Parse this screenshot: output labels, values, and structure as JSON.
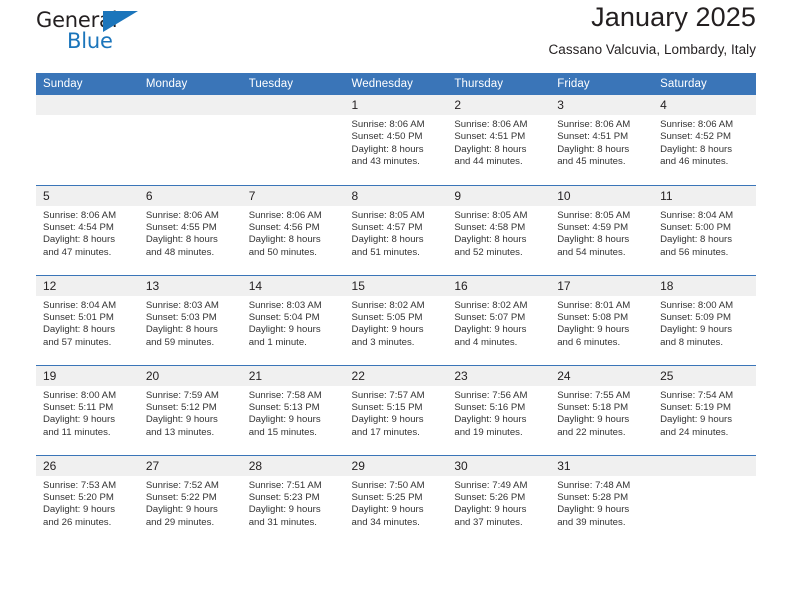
{
  "logo": {
    "word_top": "General",
    "word_bottom": "Blue",
    "triangle_color": "#1b75bb"
  },
  "header": {
    "month_title": "January 2025",
    "location": "Cassano Valcuvia, Lombardy, Italy"
  },
  "theme": {
    "header_blue": "#3a75b8",
    "daynum_band": "#f0f0f0",
    "text": "#231f20"
  },
  "weekdays": [
    "Sunday",
    "Monday",
    "Tuesday",
    "Wednesday",
    "Thursday",
    "Friday",
    "Saturday"
  ],
  "weeks": [
    [
      {
        "day": "",
        "empty": true
      },
      {
        "day": "",
        "empty": true
      },
      {
        "day": "",
        "empty": true
      },
      {
        "day": "1",
        "sunrise": "Sunrise: 8:06 AM",
        "sunset": "Sunset: 4:50 PM",
        "daylight1": "Daylight: 8 hours",
        "daylight2": "and 43 minutes."
      },
      {
        "day": "2",
        "sunrise": "Sunrise: 8:06 AM",
        "sunset": "Sunset: 4:51 PM",
        "daylight1": "Daylight: 8 hours",
        "daylight2": "and 44 minutes."
      },
      {
        "day": "3",
        "sunrise": "Sunrise: 8:06 AM",
        "sunset": "Sunset: 4:51 PM",
        "daylight1": "Daylight: 8 hours",
        "daylight2": "and 45 minutes."
      },
      {
        "day": "4",
        "sunrise": "Sunrise: 8:06 AM",
        "sunset": "Sunset: 4:52 PM",
        "daylight1": "Daylight: 8 hours",
        "daylight2": "and 46 minutes."
      }
    ],
    [
      {
        "day": "5",
        "sunrise": "Sunrise: 8:06 AM",
        "sunset": "Sunset: 4:54 PM",
        "daylight1": "Daylight: 8 hours",
        "daylight2": "and 47 minutes."
      },
      {
        "day": "6",
        "sunrise": "Sunrise: 8:06 AM",
        "sunset": "Sunset: 4:55 PM",
        "daylight1": "Daylight: 8 hours",
        "daylight2": "and 48 minutes."
      },
      {
        "day": "7",
        "sunrise": "Sunrise: 8:06 AM",
        "sunset": "Sunset: 4:56 PM",
        "daylight1": "Daylight: 8 hours",
        "daylight2": "and 50 minutes."
      },
      {
        "day": "8",
        "sunrise": "Sunrise: 8:05 AM",
        "sunset": "Sunset: 4:57 PM",
        "daylight1": "Daylight: 8 hours",
        "daylight2": "and 51 minutes."
      },
      {
        "day": "9",
        "sunrise": "Sunrise: 8:05 AM",
        "sunset": "Sunset: 4:58 PM",
        "daylight1": "Daylight: 8 hours",
        "daylight2": "and 52 minutes."
      },
      {
        "day": "10",
        "sunrise": "Sunrise: 8:05 AM",
        "sunset": "Sunset: 4:59 PM",
        "daylight1": "Daylight: 8 hours",
        "daylight2": "and 54 minutes."
      },
      {
        "day": "11",
        "sunrise": "Sunrise: 8:04 AM",
        "sunset": "Sunset: 5:00 PM",
        "daylight1": "Daylight: 8 hours",
        "daylight2": "and 56 minutes."
      }
    ],
    [
      {
        "day": "12",
        "sunrise": "Sunrise: 8:04 AM",
        "sunset": "Sunset: 5:01 PM",
        "daylight1": "Daylight: 8 hours",
        "daylight2": "and 57 minutes."
      },
      {
        "day": "13",
        "sunrise": "Sunrise: 8:03 AM",
        "sunset": "Sunset: 5:03 PM",
        "daylight1": "Daylight: 8 hours",
        "daylight2": "and 59 minutes."
      },
      {
        "day": "14",
        "sunrise": "Sunrise: 8:03 AM",
        "sunset": "Sunset: 5:04 PM",
        "daylight1": "Daylight: 9 hours",
        "daylight2": "and 1 minute."
      },
      {
        "day": "15",
        "sunrise": "Sunrise: 8:02 AM",
        "sunset": "Sunset: 5:05 PM",
        "daylight1": "Daylight: 9 hours",
        "daylight2": "and 3 minutes."
      },
      {
        "day": "16",
        "sunrise": "Sunrise: 8:02 AM",
        "sunset": "Sunset: 5:07 PM",
        "daylight1": "Daylight: 9 hours",
        "daylight2": "and 4 minutes."
      },
      {
        "day": "17",
        "sunrise": "Sunrise: 8:01 AM",
        "sunset": "Sunset: 5:08 PM",
        "daylight1": "Daylight: 9 hours",
        "daylight2": "and 6 minutes."
      },
      {
        "day": "18",
        "sunrise": "Sunrise: 8:00 AM",
        "sunset": "Sunset: 5:09 PM",
        "daylight1": "Daylight: 9 hours",
        "daylight2": "and 8 minutes."
      }
    ],
    [
      {
        "day": "19",
        "sunrise": "Sunrise: 8:00 AM",
        "sunset": "Sunset: 5:11 PM",
        "daylight1": "Daylight: 9 hours",
        "daylight2": "and 11 minutes."
      },
      {
        "day": "20",
        "sunrise": "Sunrise: 7:59 AM",
        "sunset": "Sunset: 5:12 PM",
        "daylight1": "Daylight: 9 hours",
        "daylight2": "and 13 minutes."
      },
      {
        "day": "21",
        "sunrise": "Sunrise: 7:58 AM",
        "sunset": "Sunset: 5:13 PM",
        "daylight1": "Daylight: 9 hours",
        "daylight2": "and 15 minutes."
      },
      {
        "day": "22",
        "sunrise": "Sunrise: 7:57 AM",
        "sunset": "Sunset: 5:15 PM",
        "daylight1": "Daylight: 9 hours",
        "daylight2": "and 17 minutes."
      },
      {
        "day": "23",
        "sunrise": "Sunrise: 7:56 AM",
        "sunset": "Sunset: 5:16 PM",
        "daylight1": "Daylight: 9 hours",
        "daylight2": "and 19 minutes."
      },
      {
        "day": "24",
        "sunrise": "Sunrise: 7:55 AM",
        "sunset": "Sunset: 5:18 PM",
        "daylight1": "Daylight: 9 hours",
        "daylight2": "and 22 minutes."
      },
      {
        "day": "25",
        "sunrise": "Sunrise: 7:54 AM",
        "sunset": "Sunset: 5:19 PM",
        "daylight1": "Daylight: 9 hours",
        "daylight2": "and 24 minutes."
      }
    ],
    [
      {
        "day": "26",
        "sunrise": "Sunrise: 7:53 AM",
        "sunset": "Sunset: 5:20 PM",
        "daylight1": "Daylight: 9 hours",
        "daylight2": "and 26 minutes."
      },
      {
        "day": "27",
        "sunrise": "Sunrise: 7:52 AM",
        "sunset": "Sunset: 5:22 PM",
        "daylight1": "Daylight: 9 hours",
        "daylight2": "and 29 minutes."
      },
      {
        "day": "28",
        "sunrise": "Sunrise: 7:51 AM",
        "sunset": "Sunset: 5:23 PM",
        "daylight1": "Daylight: 9 hours",
        "daylight2": "and 31 minutes."
      },
      {
        "day": "29",
        "sunrise": "Sunrise: 7:50 AM",
        "sunset": "Sunset: 5:25 PM",
        "daylight1": "Daylight: 9 hours",
        "daylight2": "and 34 minutes."
      },
      {
        "day": "30",
        "sunrise": "Sunrise: 7:49 AM",
        "sunset": "Sunset: 5:26 PM",
        "daylight1": "Daylight: 9 hours",
        "daylight2": "and 37 minutes."
      },
      {
        "day": "31",
        "sunrise": "Sunrise: 7:48 AM",
        "sunset": "Sunset: 5:28 PM",
        "daylight1": "Daylight: 9 hours",
        "daylight2": "and 39 minutes."
      },
      {
        "day": "",
        "empty": true
      }
    ]
  ]
}
